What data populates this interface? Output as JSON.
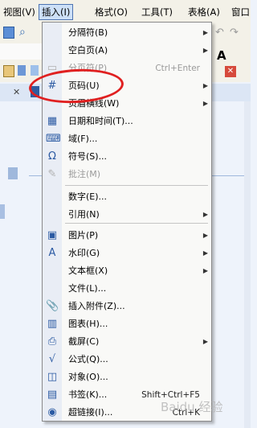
{
  "menubar": {
    "items": [
      {
        "label": "视图(V)"
      },
      {
        "label": "插入(I)"
      },
      {
        "label": "格式(O)"
      },
      {
        "label": "工具(T)"
      },
      {
        "label": "表格(A)"
      },
      {
        "label": "窗口"
      }
    ]
  },
  "insert_menu": {
    "items": [
      {
        "label": "分隔符(B)",
        "shortcut": "",
        "submenu": true,
        "disabled": false,
        "icon": ""
      },
      {
        "label": "空白页(A)",
        "shortcut": "",
        "submenu": true,
        "disabled": false,
        "icon": ""
      },
      {
        "label": "分页符(P)",
        "shortcut": "Ctrl+Enter",
        "submenu": false,
        "disabled": true,
        "icon": "page-break-icon"
      },
      {
        "label": "页码(U)",
        "shortcut": "",
        "submenu": true,
        "disabled": false,
        "icon": "page-number-icon"
      },
      {
        "label": "页眉横线(W)",
        "shortcut": "",
        "submenu": true,
        "disabled": false,
        "icon": ""
      },
      {
        "label": "日期和时间(T)...",
        "shortcut": "",
        "submenu": false,
        "disabled": false,
        "icon": "date-time-icon"
      },
      {
        "label": "域(F)...",
        "shortcut": "",
        "submenu": false,
        "disabled": false,
        "icon": "field-icon"
      },
      {
        "label": "符号(S)...",
        "shortcut": "",
        "submenu": false,
        "disabled": false,
        "icon": "omega-icon"
      },
      {
        "label": "批注(M)",
        "shortcut": "",
        "submenu": false,
        "disabled": true,
        "icon": "comment-icon"
      },
      {
        "label": "数字(E)...",
        "shortcut": "",
        "submenu": false,
        "disabled": false,
        "icon": ""
      },
      {
        "label": "引用(N)",
        "shortcut": "",
        "submenu": true,
        "disabled": false,
        "icon": ""
      },
      {
        "label": "图片(P)",
        "shortcut": "",
        "submenu": true,
        "disabled": false,
        "icon": "picture-icon"
      },
      {
        "label": "水印(G)",
        "shortcut": "",
        "submenu": true,
        "disabled": false,
        "icon": "watermark-icon"
      },
      {
        "label": "文本框(X)",
        "shortcut": "",
        "submenu": true,
        "disabled": false,
        "icon": ""
      },
      {
        "label": "文件(L)...",
        "shortcut": "",
        "submenu": false,
        "disabled": false,
        "icon": ""
      },
      {
        "label": "插入附件(Z)...",
        "shortcut": "",
        "submenu": false,
        "disabled": false,
        "icon": "attachment-icon"
      },
      {
        "label": "图表(H)...",
        "shortcut": "",
        "submenu": false,
        "disabled": false,
        "icon": "chart-icon"
      },
      {
        "label": "截屏(C)",
        "shortcut": "",
        "submenu": true,
        "disabled": false,
        "icon": "screenshot-icon"
      },
      {
        "label": "公式(Q)...",
        "shortcut": "",
        "submenu": false,
        "disabled": false,
        "icon": "formula-icon"
      },
      {
        "label": "对象(O)...",
        "shortcut": "",
        "submenu": false,
        "disabled": false,
        "icon": "object-icon"
      },
      {
        "label": "书签(K)...",
        "shortcut": "Shift+Ctrl+F5",
        "submenu": false,
        "disabled": false,
        "icon": "bookmark-icon"
      },
      {
        "label": "超链接(I)...",
        "shortcut": "Ctrl+K",
        "submenu": false,
        "disabled": false,
        "icon": "hyperlink-icon"
      }
    ]
  },
  "toolbar": {
    "font_size_glyph": "A"
  },
  "watermark": "Baidu 经验",
  "colors": {
    "highlight_oval": "#e02020",
    "active_menu": "#cde0f7"
  }
}
